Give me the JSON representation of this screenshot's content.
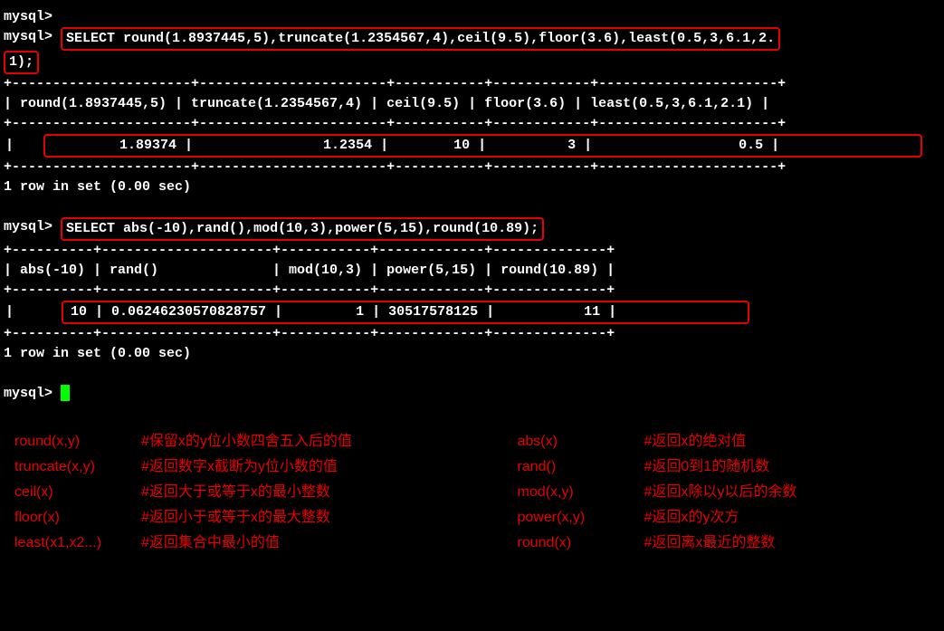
{
  "prompt": "mysql>",
  "query1_a": "SELECT round(1.8937445,5),truncate(1.2354567,4),ceil(9.5),floor(3.6),least(0.5,3,6.1,2.",
  "query1_b": "1);",
  "sep1": "+----------------------+-----------------------+-----------+------------+----------------------+",
  "head1": "| round(1.8937445,5) | truncate(1.2354567,4) | ceil(9.5) | floor(3.6) | least(0.5,3,6.1,2.1) |",
  "row1": "|             1.89374 |                1.2354 |        10 |          3 |                  0.5 |",
  "rowsinset": "1 row in set (0.00 sec)",
  "query2": "SELECT abs(-10),rand(),mod(10,3),power(5,15),round(10.89);",
  "sep2": "+----------+---------------------+-----------+-------------+--------------+",
  "head2": "| abs(-10) | rand()              | mod(10,3) | power(5,15) | round(10.89) |",
  "row2": "|       10 | 0.06246230570828757 |         1 | 30517578125 |           11 |",
  "notesL": [
    {
      "fn": "round(x,y)",
      "desc": "#保留x的y位小数四舍五入后的值"
    },
    {
      "fn": "truncate(x,y)",
      "desc": "#返回数字x截断为y位小数的值"
    },
    {
      "fn": "ceil(x)",
      "desc": "#返回大于或等于x的最小整数"
    },
    {
      "fn": "floor(x)",
      "desc": "#返回小于或等于x的最大整数"
    },
    {
      "fn": "least(x1,x2...)",
      "desc": "#返回集合中最小的值"
    }
  ],
  "notesR": [
    {
      "fn": "abs(x)",
      "desc": "#返回x的绝对值"
    },
    {
      "fn": "rand()",
      "desc": "#返回0到1的随机数"
    },
    {
      "fn": "mod(x,y)",
      "desc": "#返回x除以y以后的余数"
    },
    {
      "fn": "power(x,y)",
      "desc": "#返回x的y次方"
    },
    {
      "fn": "round(x)",
      "desc": "#返回离x最近的整数"
    }
  ]
}
